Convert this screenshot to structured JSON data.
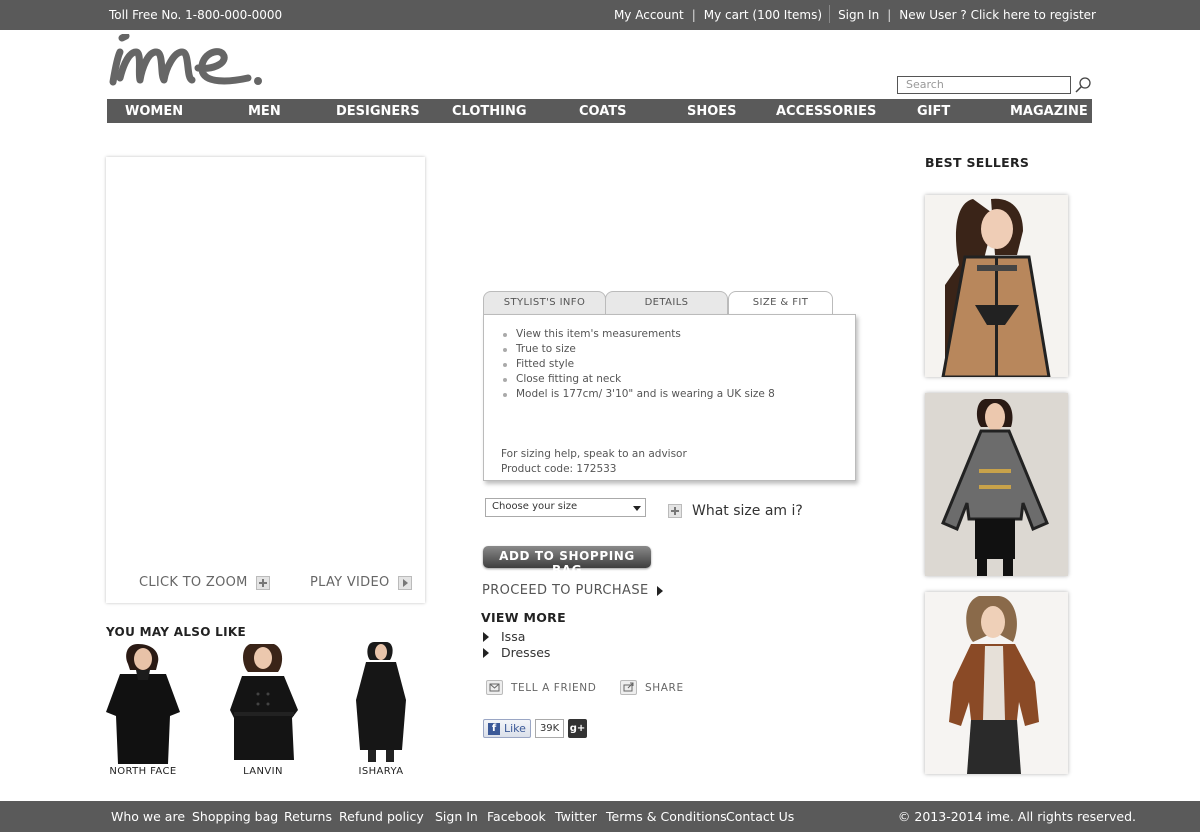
{
  "topbar": {
    "toll_free": "Toll Free No. 1-800-000-0000",
    "my_account": "My Account",
    "separator": "|",
    "my_cart": "My cart (100 Items)",
    "sign_in": "Sign In",
    "register": "New User ? Click here to register"
  },
  "search": {
    "placeholder": "Search"
  },
  "nav": [
    "WOMEN",
    "MEN",
    "DESIGNERS",
    "CLOTHING",
    "COATS",
    "SHOES",
    "ACCESSORIES",
    "GIFT",
    "MAGAZINE"
  ],
  "product_image": {
    "zoom_label": "CLICK TO ZOOM",
    "video_label": "PLAY VIDEO"
  },
  "also_like": {
    "title": "YOU MAY ALSO LIKE",
    "items": [
      "NORTH FACE",
      "LANVIN",
      "ISHARYA"
    ]
  },
  "tabs": [
    "STYLIST'S INFO",
    "DETAILS",
    "SIZE & FIT"
  ],
  "active_tab": "SIZE & FIT",
  "size_fit": {
    "bullets": [
      "View this item's measurements",
      "True to size",
      "Fitted style",
      "Close fitting at neck",
      "Model is 177cm/ 3'10\" and is wearing a UK size 8"
    ],
    "help": "For sizing help, speak to an advisor",
    "product_code": "Product code: 172533"
  },
  "size_select": {
    "value": "Choose your size"
  },
  "what_size": "What size am i?",
  "add_to_bag": "ADD TO SHOPPING BAG",
  "proceed": "PROCEED TO PURCHASE",
  "view_more": {
    "title": "VIEW MORE",
    "items": [
      "Issa",
      "Dresses"
    ]
  },
  "tell_friend": "TELL A FRIEND",
  "share": "SHARE",
  "facebook": {
    "like": "Like",
    "count": "39K"
  },
  "gplus": "g+",
  "best_sellers": {
    "title": "BEST SELLERS"
  },
  "footer": {
    "links": [
      "Who we are",
      "Shopping bag",
      "Returns",
      "Refund policy",
      "Sign In",
      "Facebook",
      "Twitter",
      "Terms & Conditions",
      "Contact Us"
    ],
    "copyright": "© 2013-2014 ime. All rights reserved."
  },
  "colors": {
    "bar": "#5a5a5a",
    "accent": "#333333"
  }
}
